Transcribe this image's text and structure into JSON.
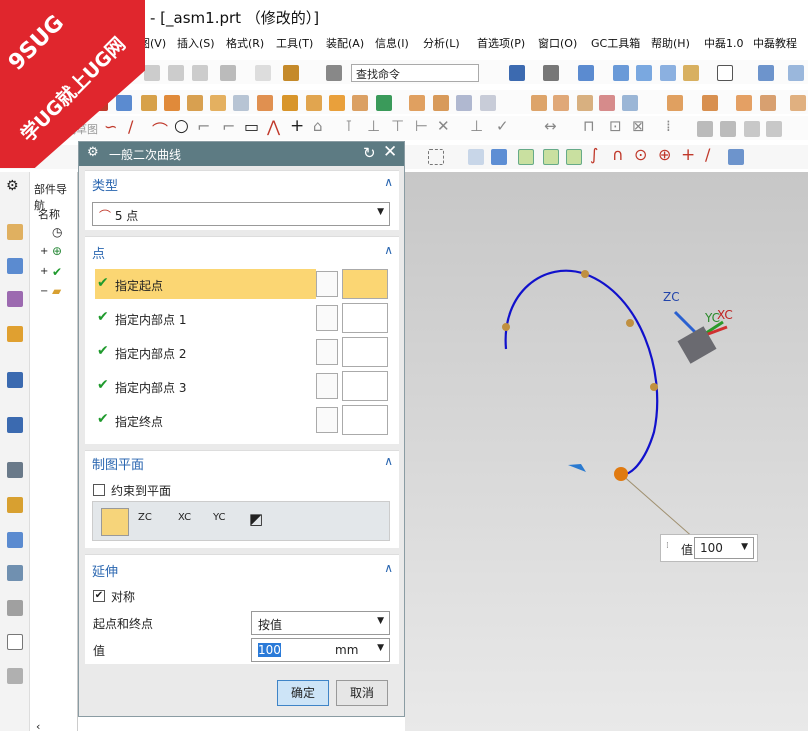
{
  "window": {
    "title": "- [_asm1.prt （修改的）]"
  },
  "watermark": {
    "line1": "9SUG",
    "line2": "学UG就上UG网"
  },
  "menu": [
    "视图(V)",
    "插入(S)",
    "格式(R)",
    "工具(T)",
    "装配(A)",
    "信息(I)",
    "分析(L)",
    "首选项(P)",
    "窗口(O)",
    "GC工具箱",
    "帮助(H)",
    "中磊1.0",
    "中磊教程"
  ],
  "toolbar": {
    "search_value": "查找命令",
    "sketch_label": "完成草图"
  },
  "nav": {
    "title": "部件导航",
    "column": "名称"
  },
  "dialog": {
    "title": "一般二次曲线",
    "type_section": "类型",
    "type_value": "5 点",
    "points_section": "点",
    "points": [
      "指定起点",
      "指定内部点 1",
      "指定内部点 2",
      "指定内部点 3",
      "指定终点"
    ],
    "plane_section": "制图平面",
    "constrain_label": "约束到平面",
    "extend_section": "延伸",
    "symmetric_label": "对称",
    "start_end_label": "起点和终点",
    "start_end_value": "按值",
    "value_label": "值",
    "value": "100",
    "unit": "mm",
    "ok": "确定",
    "cancel": "取消"
  },
  "viewport": {
    "callout_label": "值",
    "callout_value": "100",
    "axis_z": "ZC",
    "axis_y": "YC",
    "axis_x": "XC"
  }
}
